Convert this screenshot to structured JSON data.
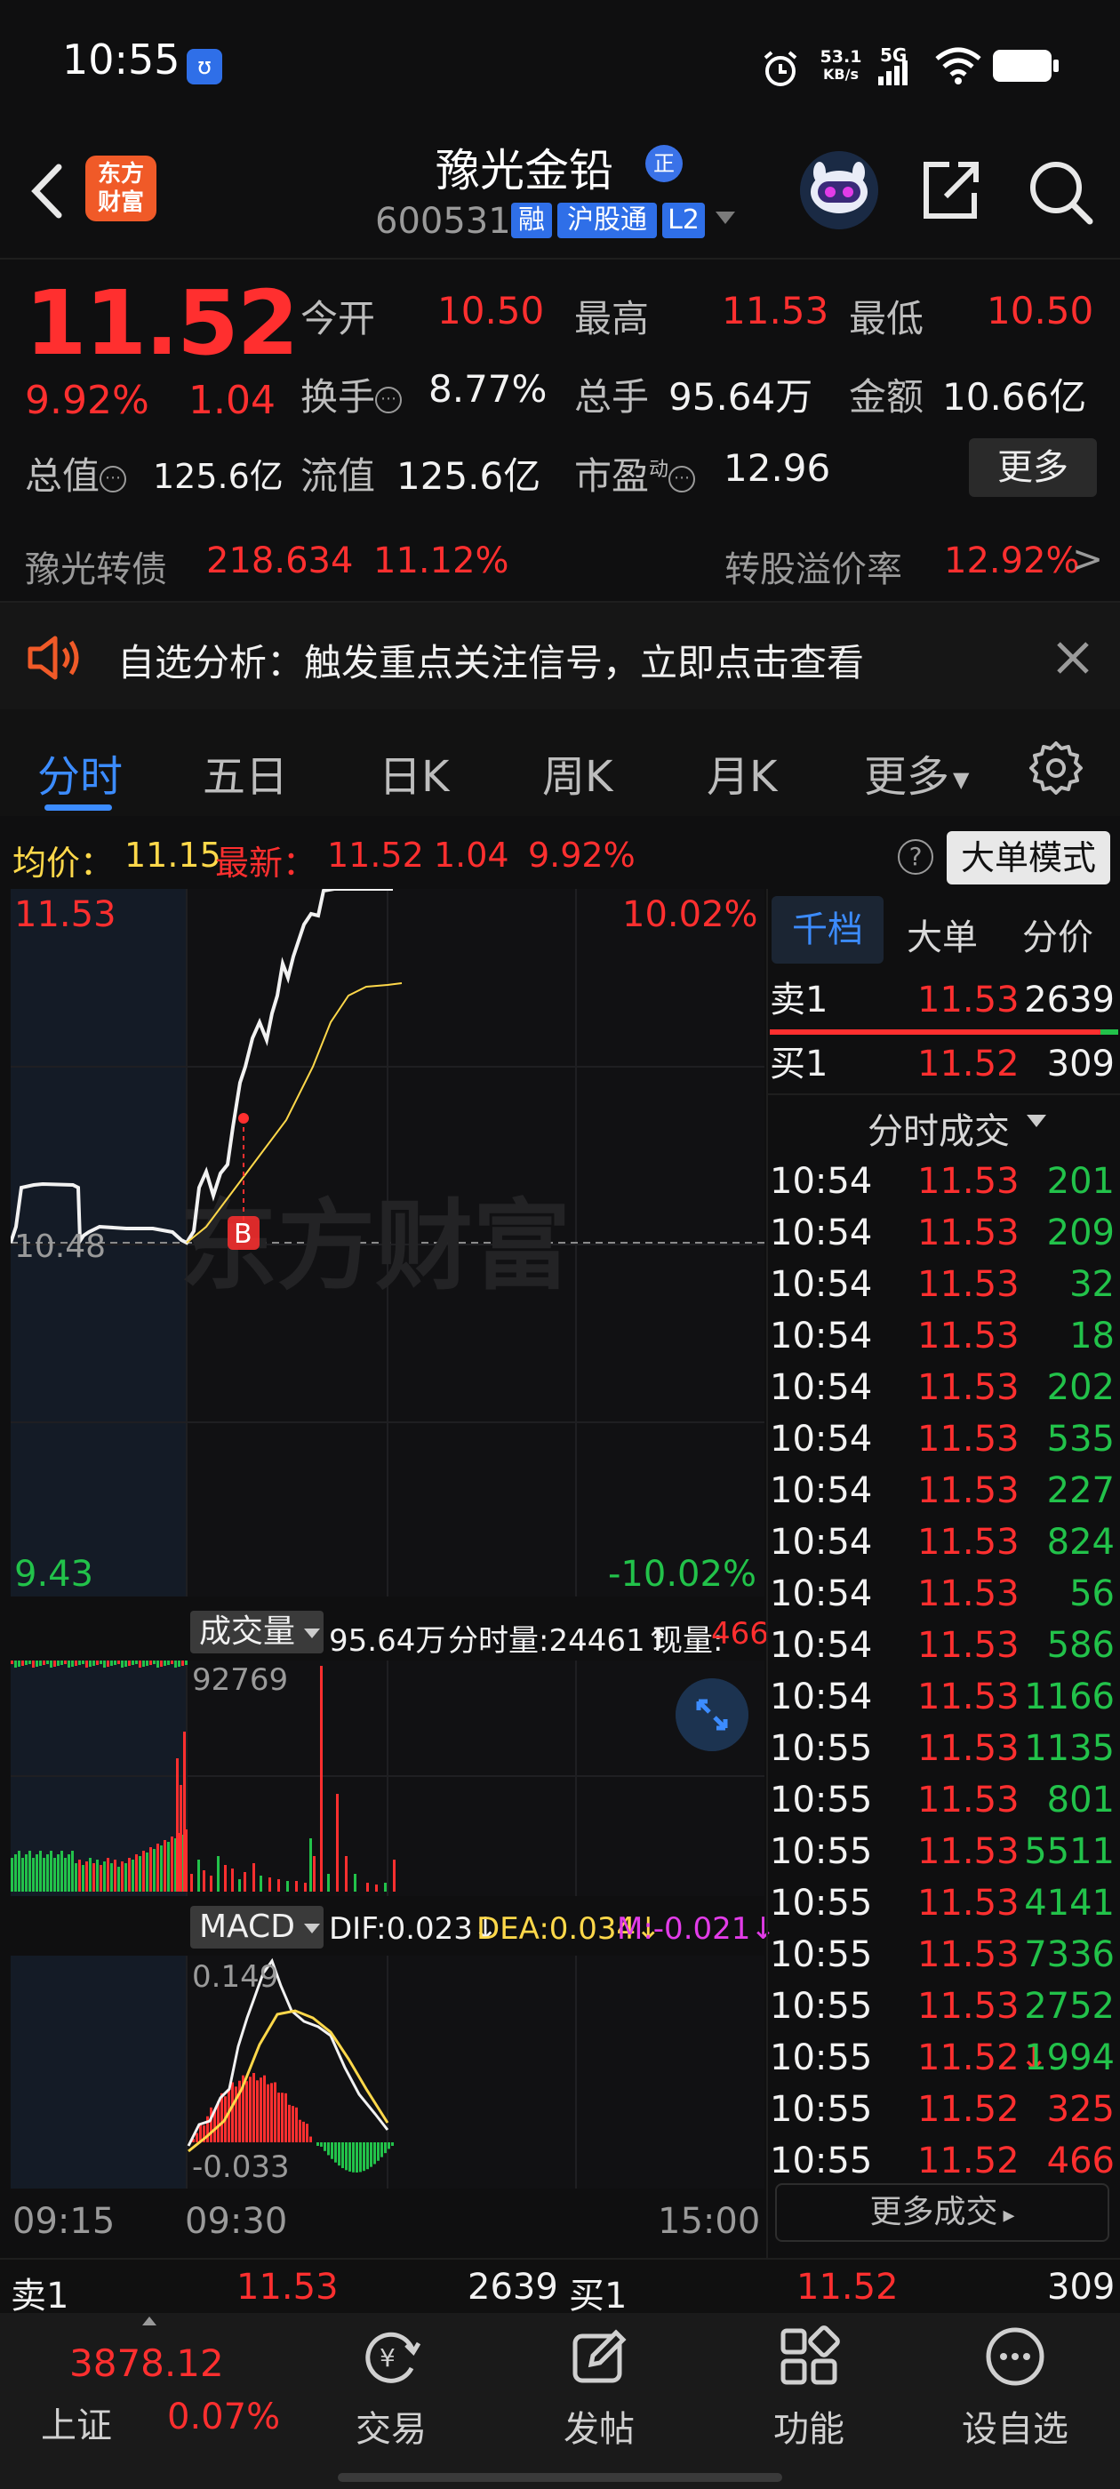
{
  "status_bar": {
    "time": "10:55",
    "net_speed_value": "53.1",
    "net_speed_unit": "KB/s",
    "network": "5G"
  },
  "header": {
    "brand_line1": "东方",
    "brand_line2": "财富",
    "stock_name": "豫光金铅",
    "name_badge": "正",
    "stock_code": "600531",
    "tags": [
      "融",
      "沪股通",
      "L2"
    ]
  },
  "quote": {
    "price": "11.52",
    "pct_change": "9.92%",
    "amt_change": "1.04",
    "open_label": "今开",
    "open": "10.50",
    "high_label": "最高",
    "high": "11.53",
    "low_label": "最低",
    "low": "10.50",
    "turnover_label": "换手",
    "turnover": "8.77%",
    "volume_label": "总手",
    "volume": "95.64万",
    "amount_label": "金额",
    "amount": "10.66亿",
    "mcap_label": "总值",
    "mcap": "125.6亿",
    "float_label": "流值",
    "float_cap": "125.6亿",
    "pe_label": "市盈",
    "pe_sup": "动",
    "pe": "12.96",
    "more_label": "更多"
  },
  "bond": {
    "name": "豫光转债",
    "price": "218.634",
    "pct": "11.12%",
    "premium_label": "转股溢价率",
    "premium": "12.92%"
  },
  "banner": {
    "text": "自选分析：触发重点关注信号，立即点击查看"
  },
  "tabs": [
    "分时",
    "五日",
    "日K",
    "周K",
    "月K",
    "更多"
  ],
  "avg_row": {
    "avg_label": "均价：",
    "avg": "11.15",
    "latest_label": "最新：",
    "latest": "11.52",
    "chg": "1.04",
    "pct": "9.92%",
    "bigorder_label": "大单模式"
  },
  "price_chart": {
    "top_price": "11.53",
    "top_pct": "10.02%",
    "bottom_price": "9.43",
    "bottom_pct": "-10.02%",
    "ref_price": "10.48",
    "marker": "B",
    "watermark": "东方财富"
  },
  "volume_panel": {
    "selector": "成交量",
    "total": "95.64万",
    "tick_label": "分时量:24461↑",
    "now_label": "现量:",
    "now": "466",
    "max_label": "92769"
  },
  "macd_panel": {
    "selector": "MACD",
    "dif": "DIF:0.023↓",
    "dea": "DEA:0.034↓",
    "m": "M:-0.021↓",
    "top_label": "0.149",
    "bottom_label": "-0.033"
  },
  "time_axis": [
    "09:15",
    "09:30",
    "15:00"
  ],
  "right_panel": {
    "tabs": [
      "千档",
      "大单",
      "分价"
    ],
    "sell1": {
      "label": "卖1",
      "price": "11.53",
      "qty": "2639"
    },
    "buy1": {
      "label": "买1",
      "price": "11.52",
      "qty": "309"
    },
    "ticks_header": "分时成交",
    "ticks": [
      {
        "t": "10:54",
        "p": "11.53",
        "v": "201",
        "c": "green"
      },
      {
        "t": "10:54",
        "p": "11.53",
        "v": "209",
        "c": "green"
      },
      {
        "t": "10:54",
        "p": "11.53",
        "v": "32",
        "c": "green"
      },
      {
        "t": "10:54",
        "p": "11.53",
        "v": "18",
        "c": "green"
      },
      {
        "t": "10:54",
        "p": "11.53",
        "v": "202",
        "c": "green"
      },
      {
        "t": "10:54",
        "p": "11.53",
        "v": "535",
        "c": "green"
      },
      {
        "t": "10:54",
        "p": "11.53",
        "v": "227",
        "c": "green"
      },
      {
        "t": "10:54",
        "p": "11.53",
        "v": "824",
        "c": "green"
      },
      {
        "t": "10:54",
        "p": "11.53",
        "v": "56",
        "c": "green"
      },
      {
        "t": "10:54",
        "p": "11.53",
        "v": "586",
        "c": "green"
      },
      {
        "t": "10:54",
        "p": "11.53",
        "v": "1166",
        "c": "green"
      },
      {
        "t": "10:55",
        "p": "11.53",
        "v": "1135",
        "c": "green"
      },
      {
        "t": "10:55",
        "p": "11.53",
        "v": "801",
        "c": "green"
      },
      {
        "t": "10:55",
        "p": "11.53",
        "v": "5511",
        "c": "green"
      },
      {
        "t": "10:55",
        "p": "11.53",
        "v": "4141",
        "c": "green"
      },
      {
        "t": "10:55",
        "p": "11.53",
        "v": "7336",
        "c": "green"
      },
      {
        "t": "10:55",
        "p": "11.53",
        "v": "2752",
        "c": "green"
      },
      {
        "t": "10:55",
        "p": "11.52↓",
        "v": "1994",
        "c": "green"
      },
      {
        "t": "10:55",
        "p": "11.52",
        "v": "325",
        "c": "red"
      },
      {
        "t": "10:55",
        "p": "11.52",
        "v": "466",
        "c": "red"
      }
    ],
    "more_trades": "更多成交"
  },
  "order_strip": {
    "sell_label": "卖1",
    "sell_price": "11.53",
    "sell_qty": "2639",
    "buy_label": "买1",
    "buy_price": "11.52",
    "buy_qty": "309"
  },
  "bottom_nav": {
    "index_value": "3878.12",
    "index_name": "上证",
    "index_pct": "0.07%",
    "items": [
      "交易",
      "发帖",
      "功能",
      "设自选"
    ]
  },
  "colors": {
    "up": "#ff2f2f",
    "down": "#22c24a",
    "avg_line": "#ffd84a",
    "accent": "#3c8cff"
  }
}
